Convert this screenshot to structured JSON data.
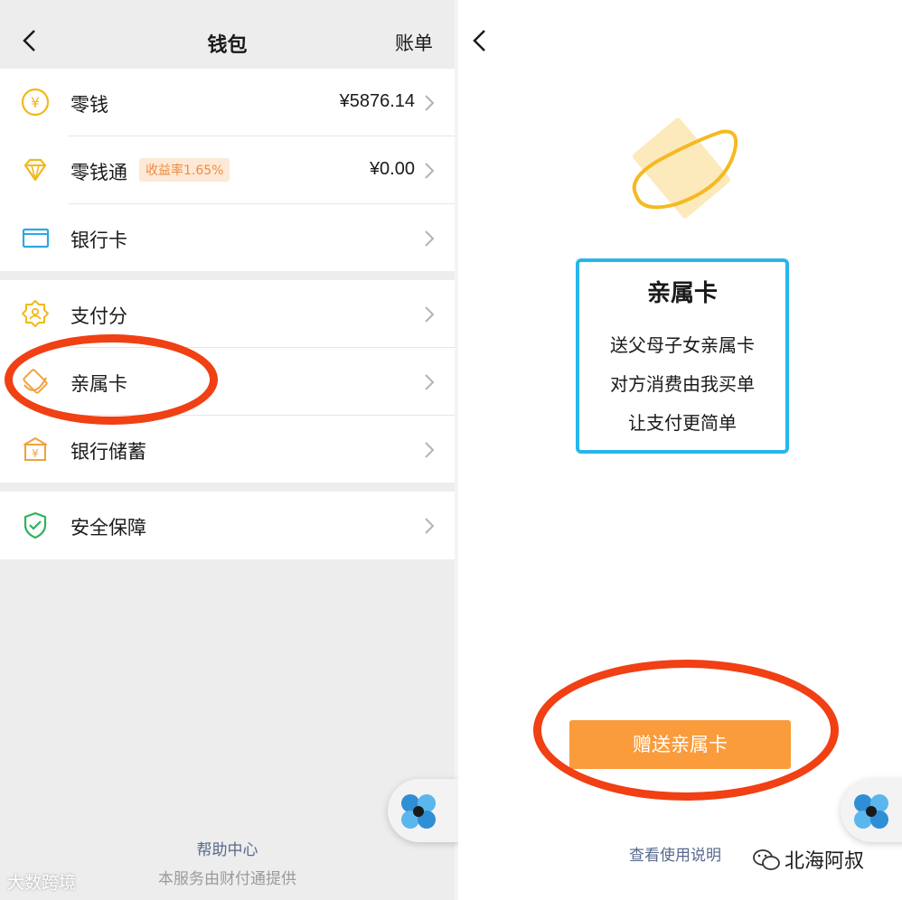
{
  "wallet": {
    "title": "钱包",
    "bill_label": "账单",
    "items": [
      {
        "label": "零钱",
        "value": "¥5876.14"
      },
      {
        "label": "零钱通",
        "badge": "收益率1.65%",
        "value": "¥0.00"
      },
      {
        "label": "银行卡"
      },
      {
        "label": "支付分"
      },
      {
        "label": "亲属卡"
      },
      {
        "label": "银行储蓄"
      },
      {
        "label": "安全保障"
      }
    ],
    "help_link": "帮助中心",
    "provided_by": "本服务由财付通提供",
    "watermark": "大数跨境"
  },
  "family_card": {
    "title": "亲属卡",
    "lines": [
      "送父母子女亲属卡",
      "对方消费由我买单",
      "让支付更简单"
    ],
    "gift_button": "赠送亲属卡",
    "usage_link": "查看使用说明",
    "watermark": "北海阿叔"
  },
  "colors": {
    "accent_orange": "#fa9c3b",
    "icon_yellow": "#f2b91c",
    "icon_blue": "#2ea7e0",
    "icon_green": "#2bb35a",
    "highlight_border": "#27b6ec",
    "annotation_red": "#f04014",
    "link_blue": "#57698c"
  }
}
